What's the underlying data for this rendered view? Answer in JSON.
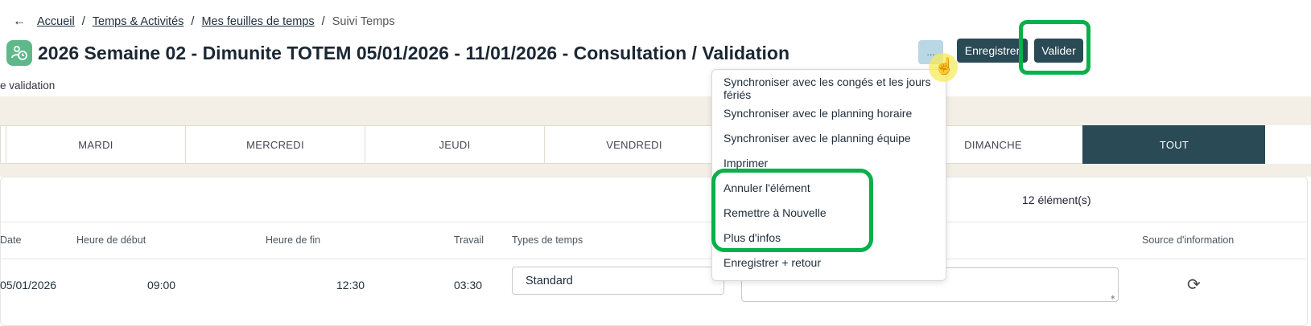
{
  "breadcrumb": {
    "back_icon": "arrow-left-icon",
    "items": [
      "Accueil",
      "Temps & Activités",
      "Mes feuilles de temps"
    ],
    "current": "Suivi Temps",
    "separator": "/"
  },
  "header": {
    "title": "2026 Semaine 02 - Dimunite TOTEM 05/01/2026 - 11/01/2026 - Consultation / Validation",
    "subtitle": "e validation",
    "more_label": "...",
    "save_label": "Enregistrer",
    "validate_label": "Valider"
  },
  "menu": {
    "items": [
      "Synchroniser avec les congés et les jours fériés",
      "Synchroniser avec le planning horaire",
      "Synchroniser avec le planning équipe",
      "Imprimer",
      "Annuler l'élément",
      "Remettre à Nouvelle",
      "Plus d'infos",
      "Enregistrer + retour"
    ]
  },
  "tabs": [
    "",
    "MARDI",
    "MERCREDI",
    "JEUDI",
    "VENDREDI",
    "",
    "DIMANCHE",
    "TOUT"
  ],
  "tabs_active_index": 7,
  "table": {
    "count": "12 élément(s)",
    "columns": [
      "Date",
      "Heure de début",
      "Heure de fin",
      "Travail",
      "Types de temps",
      "Source d'information"
    ],
    "rows": [
      {
        "date": "05/01/2026",
        "start": "09:00",
        "end": "12:30",
        "work": "03:30",
        "type": "Standard",
        "comment": "",
        "source_icon": "sync-icon"
      }
    ]
  },
  "colors": {
    "accent_dark": "#2a4a55",
    "highlight_green": "#07b04a",
    "beige": "#f4efe6",
    "app_icon": "#5fb88a"
  }
}
